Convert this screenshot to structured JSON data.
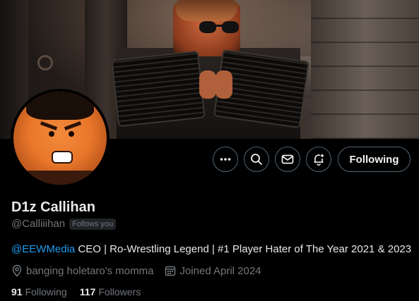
{
  "profile": {
    "display_name": "D1z Callihan",
    "handle": "@Calliiihan",
    "follows_you_badge": "Follows you",
    "bio": {
      "mention": "@EEWMedia",
      "text": " CEO | Ro-Wrestling Legend | #1 Player Hater of The Year 2021 & 2023"
    },
    "location": "banging holetaro's momma",
    "joined": "Joined April 2024",
    "following_count": "91",
    "following_label": "Following",
    "followers_count": "117",
    "followers_label": "Followers"
  },
  "actions": {
    "more_icon": "more-dots-icon",
    "grok_icon": "search-icon",
    "message_icon": "envelope-icon",
    "notify_icon": "bell-plus-icon",
    "follow_button_label": "Following"
  },
  "colors": {
    "background": "#000000",
    "text_primary": "#e7e9ea",
    "text_secondary": "#71767b",
    "accent": "#1d9bf0",
    "border": "#536471"
  }
}
